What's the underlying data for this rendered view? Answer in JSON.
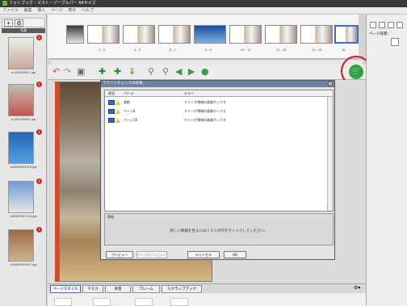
{
  "window": {
    "title": "フォトブック・マスト・ゾーブルパー A4サイズ"
  },
  "menu": [
    "ファイル",
    "編集",
    "挿入",
    "ページ",
    "表示",
    "ヘルプ"
  ],
  "left_panel": {
    "header": "写真",
    "add_label": "+",
    "settings_label": "⚙",
    "photos": [
      {
        "filename": "p-000100057.jpg",
        "badge": "2",
        "colors": [
          "#e9f1e5",
          "#c9a79b"
        ]
      },
      {
        "filename": "p-000100057.jpg",
        "badge": "2",
        "colors": [
          "#bdbdb4",
          "#c7554b"
        ]
      },
      {
        "filename": "x00495000016.jpg",
        "badge": "1",
        "colors": [
          "#2763b6",
          "#55a0e0"
        ]
      },
      {
        "filename": "x00493507134.jpg",
        "badge": "1",
        "colors": [
          "#6d9bd5",
          "#e6e6e6"
        ]
      },
      {
        "filename": "x00493597497.jpg",
        "badge": "1",
        "colors": [
          "#9b6b44",
          "#d0b391"
        ]
      }
    ]
  },
  "page_strip": {
    "spreads": [
      {
        "label": "",
        "selected": false
      },
      {
        "label": "2 - 3",
        "selected": false
      },
      {
        "label": "4 - 5",
        "selected": false
      },
      {
        "label": "6 - 7",
        "selected": false
      },
      {
        "label": "8 - 9",
        "selected": false
      },
      {
        "label": "10 - 11",
        "selected": false
      },
      {
        "label": "12 - 13",
        "selected": false
      },
      {
        "label": "14 - 15",
        "selected": false
      },
      {
        "label": "16",
        "selected": true
      }
    ]
  },
  "toolbar": {
    "icons": [
      "undo-icon",
      "redo-icon",
      "delete-icon",
      "add-page-icon",
      "add-photo-icon",
      "import-icon",
      "zoom-in-icon",
      "zoom-out-icon",
      "prev-icon",
      "next-icon",
      "info-icon"
    ]
  },
  "dialog": {
    "title": "プライトチェックの結果...",
    "close_label": "×",
    "columns": [
      "状況",
      "ページ",
      "エラー"
    ],
    "rows": [
      {
        "page": "表紙",
        "error": "ドリング領域の画像ボックス"
      },
      {
        "page": "ページ8",
        "error": "ドリング領域の画像ボックス"
      },
      {
        "page": "ページ16",
        "error": "ドリング領域の画像ボックス"
      }
    ],
    "info_label": "情報",
    "info_message": "詳しい情報を見るにはリストの行をクリックしてください。",
    "buttons": {
      "preview": "プレビュー",
      "page_preview": "ページのプレビュー",
      "cancel": "キャンセル",
      "ok": "OK"
    }
  },
  "right_panel": {
    "label": "ページ背景："
  },
  "bottom_tabs": [
    "ページスタイル",
    "マスク",
    "背景",
    "フレーム",
    "スクラップブック"
  ],
  "colors": {
    "accent": "#3d6fc2",
    "badge": "#d2281e",
    "cart": "#2fa43b",
    "highlight_ring": "#d1161a"
  }
}
